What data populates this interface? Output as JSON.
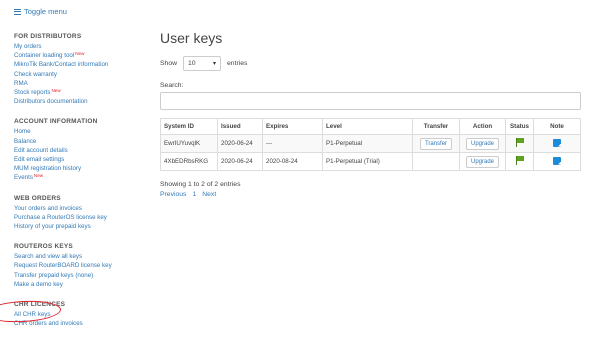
{
  "header": {
    "toggle_label": "Toggle menu"
  },
  "sidebar": {
    "sections": [
      {
        "title": "FOR DISTRIBUTORS",
        "items": [
          {
            "label": "My orders",
            "new": ""
          },
          {
            "label": "Container loading tool",
            "new": "New"
          },
          {
            "label": "MikroTik Bank/Contact information",
            "new": ""
          },
          {
            "label": "Check warranty",
            "new": ""
          },
          {
            "label": "RMA",
            "new": ""
          },
          {
            "label": "Stock reports",
            "new": "New"
          },
          {
            "label": "Distributors documentation",
            "new": ""
          }
        ]
      },
      {
        "title": "ACCOUNT INFORMATION",
        "items": [
          {
            "label": "Home",
            "new": ""
          },
          {
            "label": "Balance",
            "new": ""
          },
          {
            "label": "Edit account details",
            "new": ""
          },
          {
            "label": "Edit email settings",
            "new": ""
          },
          {
            "label": "MUM registration history",
            "new": ""
          },
          {
            "label": "Events",
            "new": "New"
          }
        ]
      },
      {
        "title": "WEB ORDERS",
        "items": [
          {
            "label": "Your orders and invoices",
            "new": ""
          },
          {
            "label": "Purchase a RouterOS license key",
            "new": ""
          },
          {
            "label": "History of your prepaid keys",
            "new": ""
          }
        ]
      },
      {
        "title": "ROUTEROS KEYS",
        "items": [
          {
            "label": "Search and view all keys",
            "new": ""
          },
          {
            "label": "Request RouterBOARD license key",
            "new": ""
          },
          {
            "label": "Transfer prepaid keys (none)",
            "new": ""
          },
          {
            "label": "Make a demo key",
            "new": ""
          }
        ]
      },
      {
        "title": "CHR LICENCES",
        "items": [
          {
            "label": "All CHR keys",
            "new": ""
          },
          {
            "label": "CHR orders and invoices",
            "new": ""
          }
        ]
      }
    ]
  },
  "main": {
    "title": "User keys",
    "show_label": "Show",
    "entries_value": "10",
    "entries_label": "entries",
    "search_label": "Search:",
    "search_value": "",
    "columns": [
      "System ID",
      "Issued",
      "Expires",
      "Level",
      "Transfer",
      "Action",
      "Status",
      "Note"
    ],
    "rows": [
      {
        "system_id": "EwrIUYuvqlK",
        "issued": "2020-06-24",
        "expires": "---",
        "level": "P1-Perpetual",
        "transfer": "Transfer",
        "action": "Upgrade",
        "status": "flag-icon",
        "note": "note-icon"
      },
      {
        "system_id": "4XbEDRbsRKG",
        "issued": "2020-06-24",
        "expires": "2020-08-24",
        "level": "P1-Perpetual (Trial)",
        "transfer": "",
        "action": "Upgrade",
        "status": "flag-icon",
        "note": "note-icon"
      }
    ],
    "info": "Showing 1 to 2 of 2 entries",
    "pager": {
      "previous": "Previous",
      "page": "1",
      "next": "Next"
    }
  },
  "colors": {
    "link": "#337ab7",
    "new_badge": "#e0222a",
    "flag": "#5fa31e",
    "note": "#1e8bd8",
    "highlight_circle": "#e0222a"
  }
}
